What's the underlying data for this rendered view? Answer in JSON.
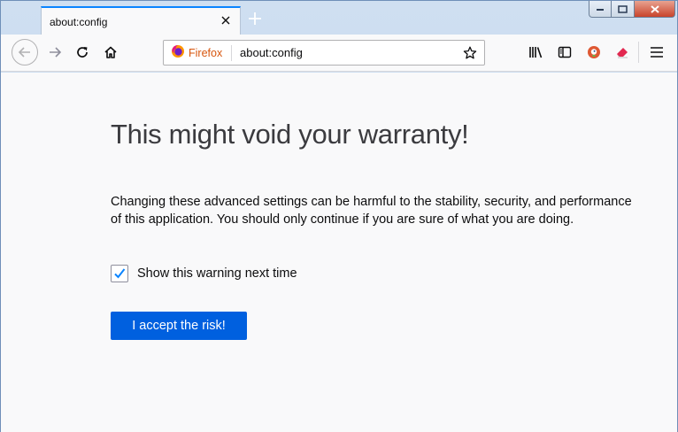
{
  "tab": {
    "title": "about:config"
  },
  "urlbar": {
    "identity_label": "Firefox",
    "url": "about:config"
  },
  "content": {
    "heading": "This might void your warranty!",
    "description": "Changing these advanced settings can be harmful to the stability, security, and performance of this application. You should only continue if you are sure of what you are doing.",
    "checkbox": {
      "label": "Show this warning next time",
      "checked": true
    },
    "accept_button": "I accept the risk!"
  },
  "icons": {
    "tab_close": "close-icon",
    "new_tab": "plus-icon",
    "back": "arrow-left-icon",
    "forward": "arrow-right-icon",
    "reload": "reload-icon",
    "home": "home-icon",
    "firefox": "firefox-logo-icon",
    "bookmark": "star-icon",
    "library": "library-icon",
    "sidebar": "sidebar-icon",
    "duckduckgo": "duckduckgo-icon",
    "eraser": "eraser-icon",
    "menu": "hamburger-menu-icon"
  },
  "colors": {
    "accent": "#0a84ff",
    "button": "#0060df",
    "firefox_label": "#d7560e"
  }
}
